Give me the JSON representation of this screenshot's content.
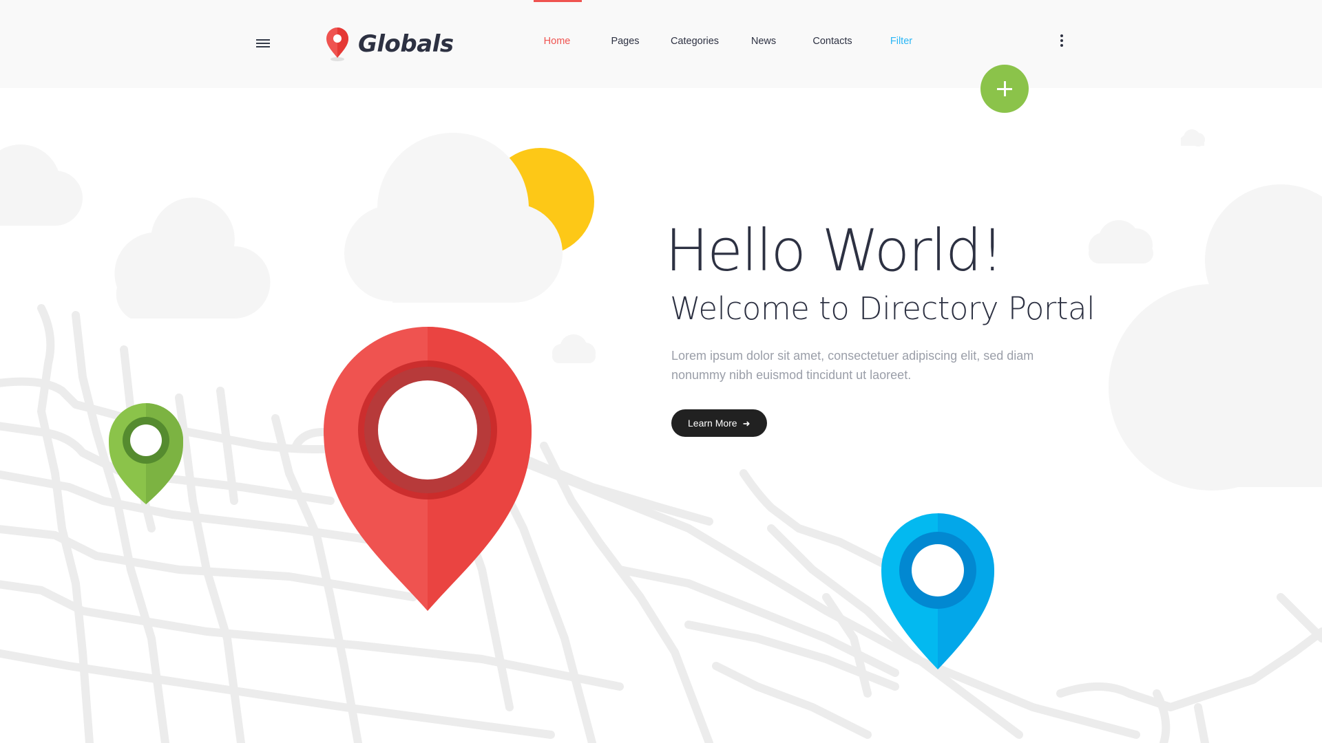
{
  "header": {
    "logo_text": "Globals",
    "nav": [
      {
        "label": "Home",
        "state": "active",
        "color": "#ef5350"
      },
      {
        "label": "Pages",
        "state": "default",
        "color": "#2d3142"
      },
      {
        "label": "Categories",
        "state": "default",
        "color": "#2d3142"
      },
      {
        "label": "News",
        "state": "default",
        "color": "#2d3142"
      },
      {
        "label": "Contacts",
        "state": "default",
        "color": "#2d3142"
      },
      {
        "label": "Filter",
        "state": "highlight",
        "color": "#29b6f6"
      }
    ],
    "menu_icon": "hamburger-icon",
    "more_icon": "vertical-dots-icon",
    "fab_icon": "plus-icon"
  },
  "hero": {
    "title": "Hello World!",
    "subtitle": "Welcome to Directory Portal",
    "body": "Lorem ipsum dolor sit amet, consectetuer adipiscing elit, sed diam nonummy nibh euismod tincidunt ut laoreet.",
    "cta_label": "Learn More",
    "cta_icon": "arrow-right-icon"
  },
  "colors": {
    "accent_red": "#ef5350",
    "accent_green": "#8bc34a",
    "accent_blue": "#03b9f0",
    "sun": "#fdc817",
    "dark": "#2d3142",
    "map_lines": "#ebebeb"
  }
}
